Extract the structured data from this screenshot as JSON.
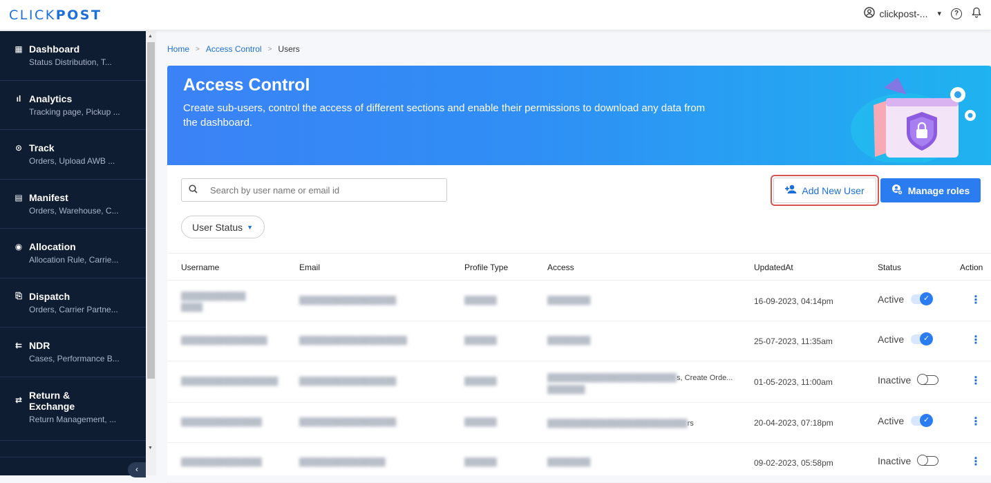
{
  "brand": {
    "logo_light": "CLICK",
    "logo_bold": "POST"
  },
  "topbar": {
    "account_label": "clickpost-...",
    "chevron": "⌄",
    "help": "?",
    "bell": "🔔"
  },
  "sidebar": {
    "items": [
      {
        "title": "Dashboard",
        "sub": "Status Distribution, T...",
        "icon": "dashboard-icon"
      },
      {
        "title": "Analytics",
        "sub": "Tracking page, Pickup ...",
        "icon": "bar-chart-icon"
      },
      {
        "title": "Track",
        "sub": "Orders, Upload AWB ...",
        "icon": "location-pin-icon"
      },
      {
        "title": "Manifest",
        "sub": "Orders, Warehouse, C...",
        "icon": "list-icon"
      },
      {
        "title": "Allocation",
        "sub": "Allocation Rule, Carrie...",
        "icon": "target-icon"
      },
      {
        "title": "Dispatch",
        "sub": "Orders, Carrier Partne...",
        "icon": "clipboard-icon"
      },
      {
        "title": "NDR",
        "sub": "Cases, Performance B...",
        "icon": "ndr-icon"
      },
      {
        "title_line1": "Return &",
        "title_line2": "Exchange",
        "sub": "Return Management, ...",
        "icon": "swap-icon"
      }
    ],
    "collapse": "‹"
  },
  "breadcrumb": {
    "home": "Home",
    "section": "Access Control",
    "current": "Users"
  },
  "banner": {
    "title": "Access Control",
    "description": "Create sub-users, control the access of different sections and enable their permissions to download any data from the dashboard."
  },
  "search": {
    "placeholder": "Search by user name or email id"
  },
  "buttons": {
    "add_user": "Add New User",
    "manage_roles": "Manage roles"
  },
  "filter": {
    "label": "User Status"
  },
  "table": {
    "headers": {
      "username": "Username",
      "email": "Email",
      "profile": "Profile Type",
      "access": "Access",
      "updated": "UpdatedAt",
      "status": "Status",
      "action": "Action"
    },
    "rows": [
      {
        "updated": "16-09-2023, 04:14pm",
        "status": "Active",
        "access_extra": ""
      },
      {
        "updated": "25-07-2023, 11:35am",
        "status": "Active",
        "access_extra": ""
      },
      {
        "updated": "01-05-2023, 11:00am",
        "status": "Inactive",
        "access_extra": "s, Create Orde..."
      },
      {
        "updated": "20-04-2023, 07:18pm",
        "status": "Active",
        "access_extra": "rs"
      },
      {
        "updated": "09-02-2023, 05:58pm",
        "status": "Inactive",
        "access_extra": ""
      }
    ]
  },
  "colors": {
    "brand_blue": "#1d6fd8",
    "sidebar_bg": "#0f1d33",
    "primary_button": "#2b7bf1",
    "highlight_red": "#d9534f"
  }
}
